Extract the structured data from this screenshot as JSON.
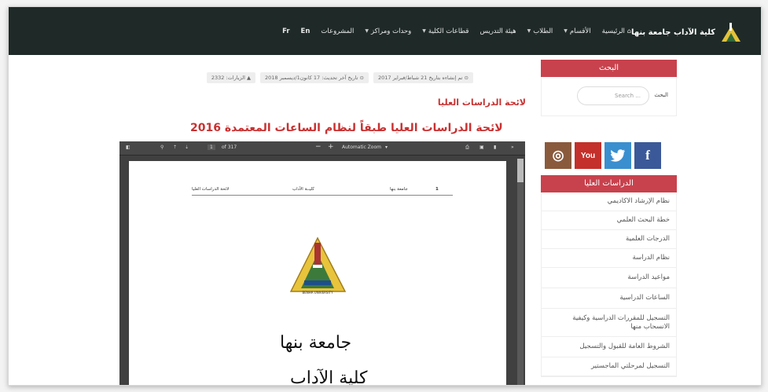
{
  "nav": {
    "logo_text": "كلية الآداب جامعة بنها",
    "items": [
      {
        "label": "الرئيسية",
        "caret": false
      },
      {
        "label": "الأقسام",
        "caret": true
      },
      {
        "label": "الطلاب",
        "caret": true
      },
      {
        "label": "هيئة التدريس",
        "caret": false
      },
      {
        "label": "قطاعات الكلية",
        "caret": true
      },
      {
        "label": "وحدات ومراكز",
        "caret": true
      },
      {
        "label": "المشروعات",
        "caret": false
      },
      {
        "label": "En",
        "caret": false
      },
      {
        "label": "Fr",
        "caret": false
      }
    ]
  },
  "meta": {
    "published": "تم إنشاءه بتاريخ 21 شباط/فبراير 2017",
    "updated": "تاريخ آخر تحديث: 17 كانون1/ديسمبر 2018",
    "visits": "الزيارات: 2332"
  },
  "page_title": "لائحة الدراسات العليا",
  "doc_title": "لائحة الدراسات العليا طبقاً لنظام الساعات المعتمدة 2016",
  "search": {
    "heading": "البحث",
    "label": "البحث",
    "placeholder": "Search ..."
  },
  "social": {
    "facebook": "f",
    "twitter": "t",
    "youtube": "You",
    "instagram": "◎"
  },
  "grad": {
    "heading": "الدراسات العليا",
    "items": [
      "نظام الإرشاد الاكاديمي",
      "خطة البحث العلمي",
      "الدرجات العلمية",
      "نظام الدراسة",
      "مواعيد الدراسة",
      "الساعات الدراسية",
      "التسجيل للمقررات الدراسية وكيفية الانسحاب منها",
      "الشروط العامة للقبول والتسجيل",
      "التسجيل لمرحلتي الماجستير"
    ]
  },
  "pdf": {
    "page_input": "1",
    "page_count": "of 317",
    "zoom": "Automatic Zoom",
    "page_header_right": "جامعة بنها",
    "page_header_mid": "كليــة الآداب",
    "page_header_left": "لائحة الدراسات العليا",
    "page_number": "1",
    "body_line1": "جامعة بنها",
    "body_line2": "كلية الآداب"
  },
  "colors": {
    "nav_bg": "#1f2a28",
    "accent_red": "#c8424d",
    "title_red": "#c83131",
    "facebook": "#3b5998",
    "twitter": "#3a8fcf",
    "youtube": "#c4302b",
    "instagram": "#8a5a3c"
  }
}
